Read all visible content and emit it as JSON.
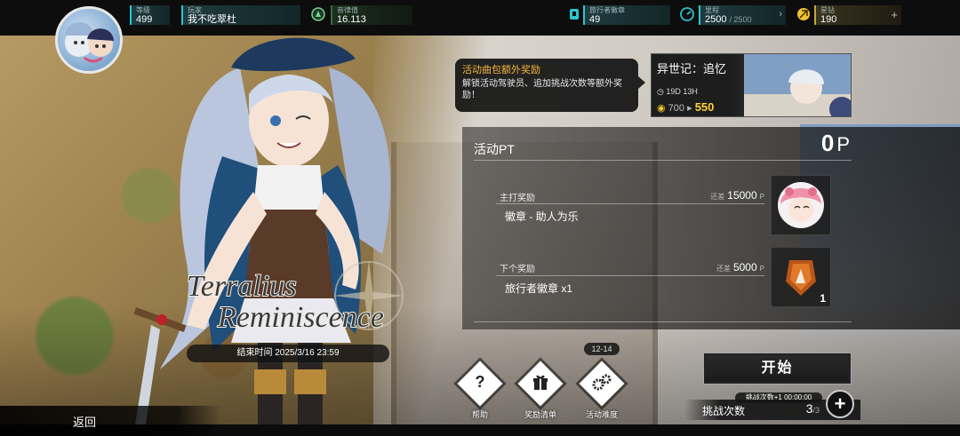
{
  "topbar": {
    "level": {
      "label": "等级",
      "value": "499"
    },
    "player": {
      "label": "玩家",
      "value": "我不吃翠杜"
    },
    "rhythm": {
      "label": "音律值",
      "value": "16.113"
    },
    "badge": {
      "label": "旅行者徽章",
      "value": "49"
    },
    "mileage": {
      "label": "里程",
      "value": "2500",
      "max": "/ 2500"
    },
    "stardiamond": {
      "label": "星钻",
      "value": "190"
    }
  },
  "event_tip": {
    "title": "活动曲包额外奖励",
    "desc": "解锁活动驾驶员、追加挑战次数等额外奖励！"
  },
  "event_card": {
    "title": "异世记：追忆",
    "timer": "19D 13H",
    "cost_old": "700",
    "cost_new": "550"
  },
  "points": {
    "label": "活动PT",
    "value": "0",
    "unit": "P"
  },
  "rewards": [
    {
      "title": "主打奖励",
      "need_prefix": "还差",
      "need": "15000",
      "need_unit": "P",
      "name": "徽章 - 助人为乐"
    },
    {
      "title": "下个奖励",
      "need_prefix": "还差",
      "need": "5000",
      "need_unit": "P",
      "name": "旅行者徽章 x1",
      "qty": "1"
    }
  ],
  "end_time": "结束时间 2025/3/16 23:59",
  "actions": {
    "help": "帮助",
    "reward_list": "奖励清单",
    "difficulty": "活动难度",
    "difficulty_range": "12-14"
  },
  "start_label": "开始",
  "challenge": {
    "bonus": "挑战次数+1  00:00:00",
    "label": "挑战次数",
    "count": "3",
    "max": "/3"
  },
  "back_label": "返回",
  "colors": {
    "accent": "#29c6cf",
    "gold": "#f4b73a",
    "cost": "#ffd23a"
  }
}
